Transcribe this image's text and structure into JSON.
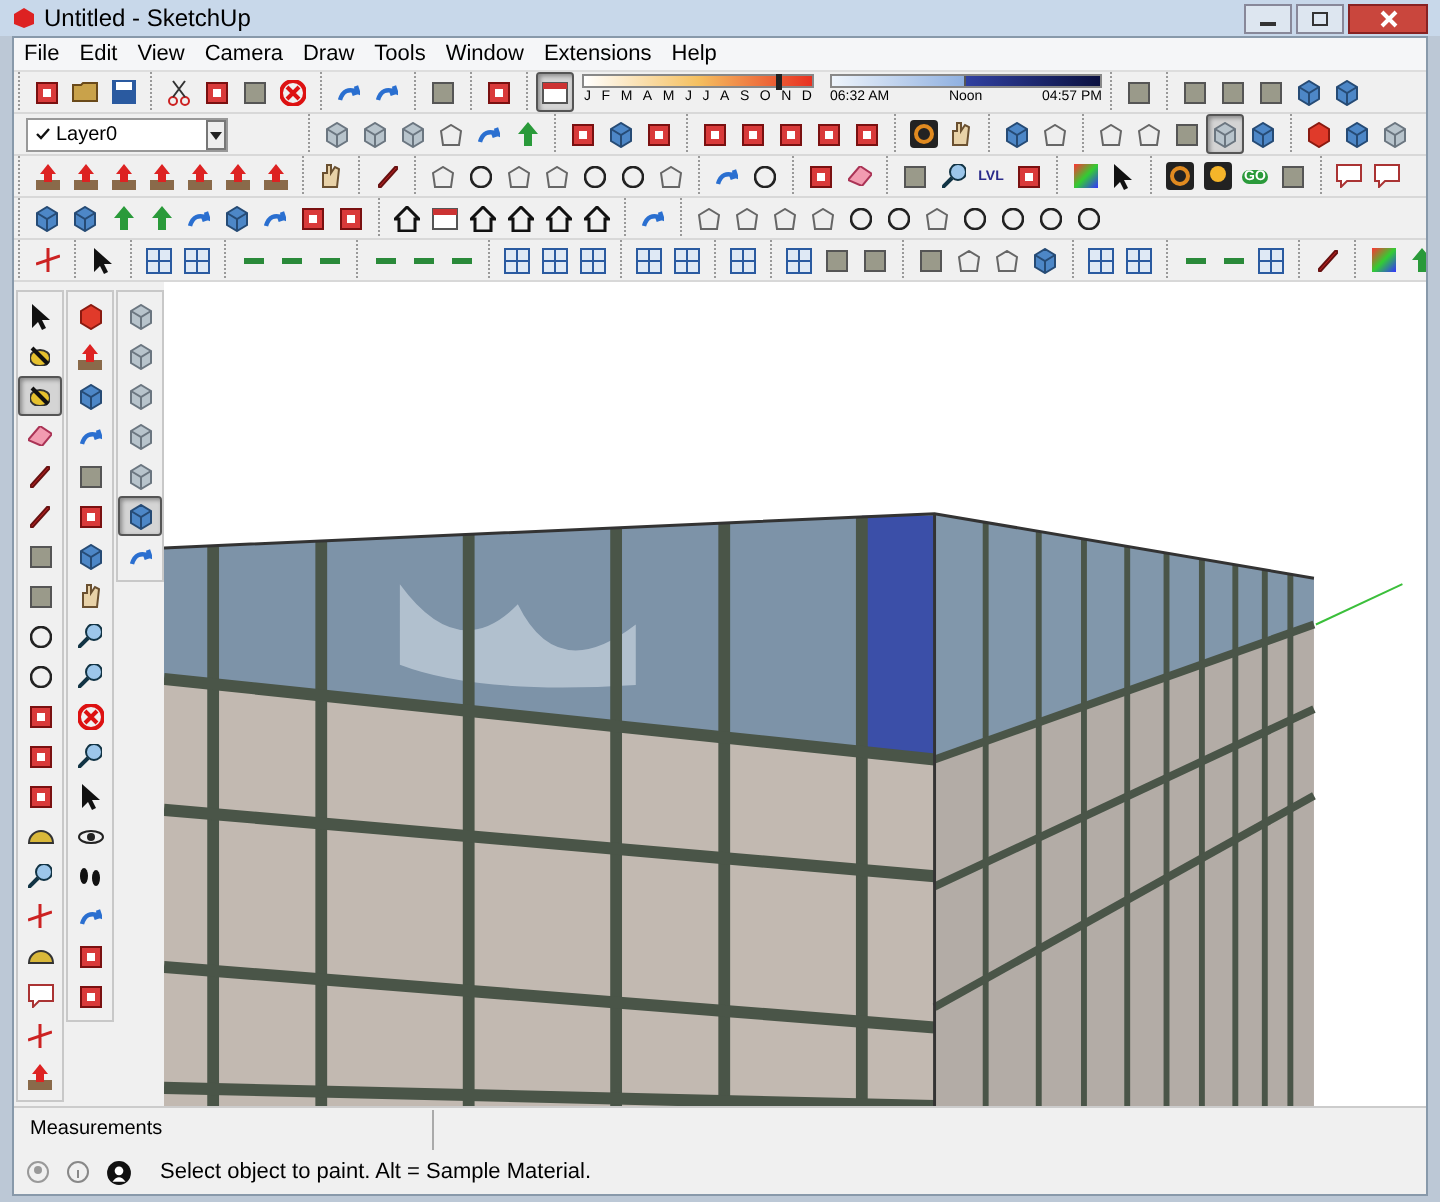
{
  "window": {
    "title": "Untitled - SketchUp"
  },
  "menu": [
    "File",
    "Edit",
    "View",
    "Camera",
    "Draw",
    "Tools",
    "Window",
    "Extensions",
    "Help"
  ],
  "layers": {
    "current": "Layer0",
    "checked": true
  },
  "shadows": {
    "selected": true,
    "months": [
      "J",
      "F",
      "M",
      "A",
      "M",
      "J",
      "J",
      "A",
      "S",
      "O",
      "N",
      "D"
    ],
    "month_slider": {
      "level": 0.84
    },
    "time_slider": {
      "level": 0.5
    },
    "times": [
      "06:32 AM",
      "Noon",
      "04:57 PM"
    ]
  },
  "styles": [
    {
      "selected": false
    },
    {
      "selected": false
    },
    {
      "selected": false
    },
    {
      "selected": true
    },
    {
      "selected": false
    }
  ],
  "icon_texts": {
    "level": "LVL",
    "go": "GO"
  },
  "tool_palette": {
    "column_1": [
      {
        "selected": false
      },
      {
        "selected": false
      },
      {
        "selected": true
      },
      {
        "selected": false
      },
      {
        "selected": false
      },
      {
        "selected": false
      },
      {
        "selected": false
      },
      {
        "selected": false
      },
      {
        "selected": false
      },
      {
        "selected": false
      },
      {
        "selected": false
      },
      {
        "selected": false
      },
      {
        "selected": false
      },
      {
        "selected": false
      },
      {
        "selected": false
      },
      {
        "selected": false
      },
      {
        "selected": false
      },
      {
        "selected": false
      },
      {
        "selected": false
      },
      {
        "selected": false
      }
    ],
    "column_2": [
      {
        "selected": false
      },
      {
        "selected": false
      },
      {
        "selected": false
      },
      {
        "selected": false
      },
      {
        "selected": false
      },
      {
        "selected": false
      },
      {
        "selected": false
      },
      {
        "selected": false
      },
      {
        "selected": false
      },
      {
        "selected": false
      },
      {
        "selected": false
      },
      {
        "selected": false
      },
      {
        "selected": false
      },
      {
        "selected": false
      },
      {
        "selected": false
      },
      {
        "selected": false
      },
      {
        "selected": false
      },
      {
        "selected": false
      }
    ],
    "column_3": [
      {
        "selected": false
      },
      {
        "selected": false
      },
      {
        "selected": false
      },
      {
        "selected": false
      },
      {
        "selected": false
      },
      {
        "selected": true
      },
      {
        "selected": false
      }
    ]
  },
  "measurements": {
    "label": "Measurements"
  },
  "status_bar": {
    "message": "Select object to paint. Alt = Sample Material."
  }
}
